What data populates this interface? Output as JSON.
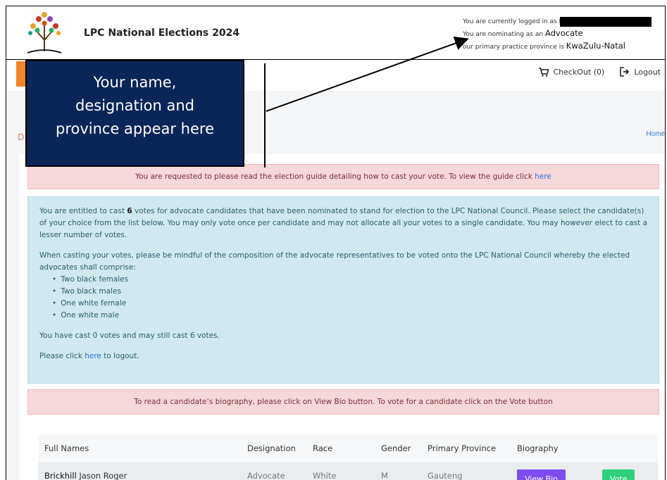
{
  "header": {
    "app_title": "LPC National Elections 2024",
    "logged_in_prefix": "You are currently logged in as E",
    "nominating_prefix": "You are nominating as an",
    "nominating_value": "Advocate",
    "province_prefix": "our primary practice province is",
    "province_value": "KwaZulu-Natal"
  },
  "navbar": {
    "checkout_label": "CheckOut (0)",
    "logout_label": "Logout"
  },
  "breadcrumb": {
    "title_initial": "D",
    "home_label": "Home"
  },
  "alerts": {
    "guide_text": "You are requested to please read the election guide detailing how to cast your vote. To view the guide click",
    "guide_link": "here",
    "info_p1_a": "You are entitled to cast",
    "info_p1_count": "6",
    "info_p1_b": "votes for advocate candidates that have been nominated to stand for election to the LPC National Council. Please select the candidate(s) of your choice from the list below. You may only vote once per candidate and may not allocate all your votes to a single candidate. You may however elect to cast a lesser number of votes.",
    "info_p2": "When casting your votes, please be mindful of the composition of the advocate representatives to be voted onto the LPC National Council whereby the elected advocates shall comprise:",
    "composition": [
      "Two black females",
      "Two black males",
      "One white female",
      "One white male"
    ],
    "votes_status": "You have cast 0 votes and may still cast 6 votes.",
    "logout_prefix": "Please click",
    "logout_link": "here",
    "logout_suffix": "to logout.",
    "bio_text": "To read a candidate’s biography, please click on View Bio button. To vote for a candidate click on the Vote button"
  },
  "table": {
    "headers": [
      "Full Names",
      "Designation",
      "Race",
      "Gender",
      "Primary Province",
      "Biography",
      ""
    ],
    "rows": [
      {
        "surname": "Brickhill",
        "given": "Jason Roger",
        "designation": "Advocate",
        "race": "White",
        "gender": "M",
        "province": "Gauteng",
        "bio_btn": "View Bio",
        "vote_btn": "Vote"
      }
    ]
  },
  "annotation": {
    "line1": "Your name,",
    "line2": "designation and",
    "line3": "province appear here"
  },
  "colors": {
    "annotation_bg": "#0a2558",
    "nav_accent": "#f0852b",
    "alert_pink": "#f6d7da",
    "alert_info": "#cfe9ee",
    "view_bio": "#7b4df0",
    "vote": "#2ed07b",
    "link": "#2e6ed6"
  }
}
